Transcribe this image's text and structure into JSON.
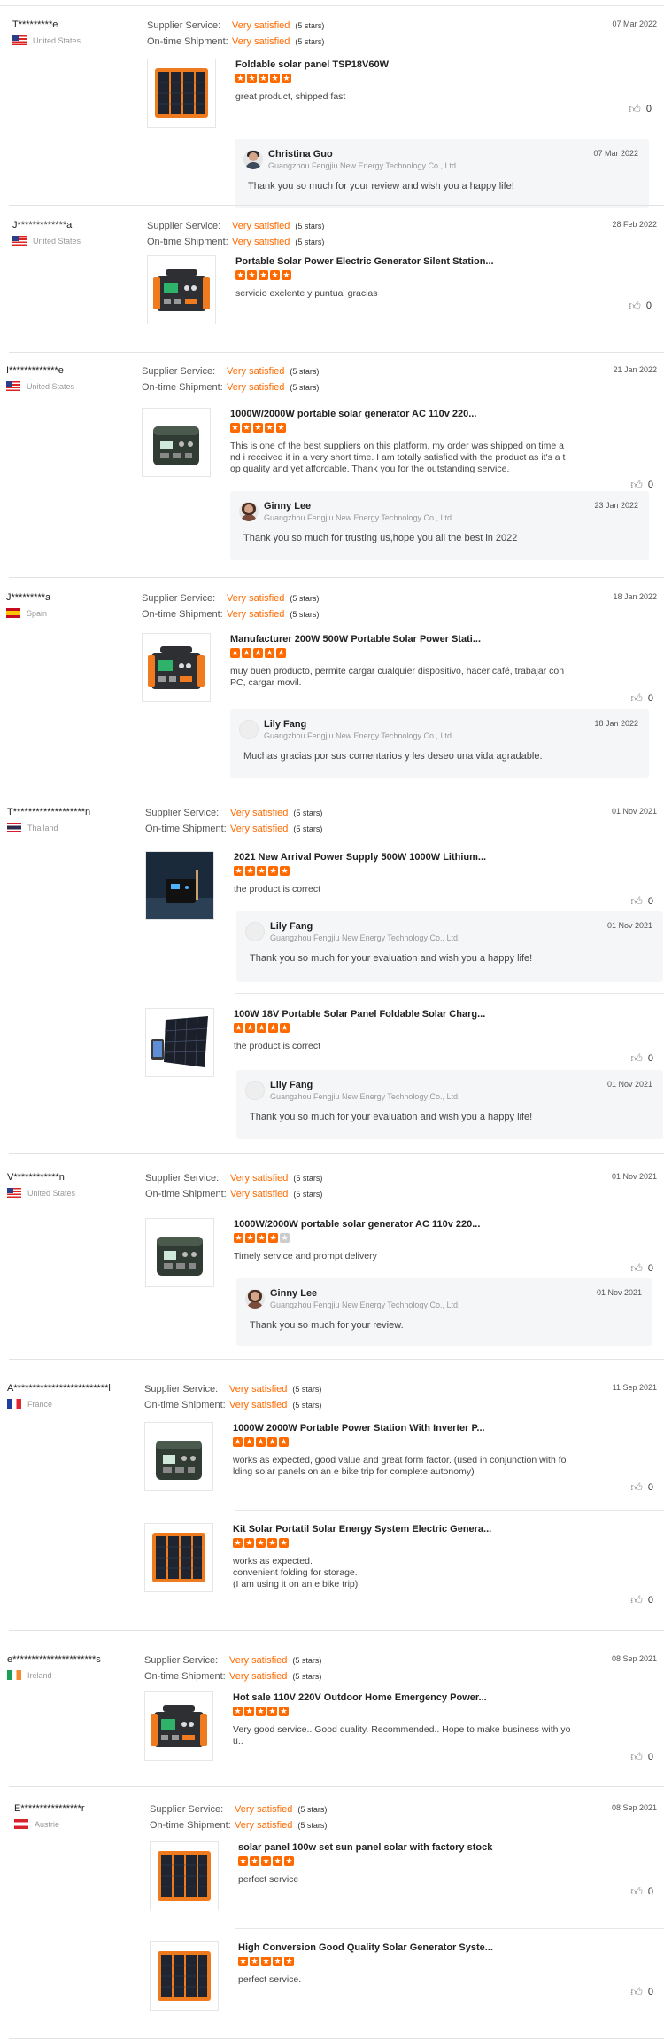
{
  "labels": {
    "supplier_service": "Supplier Service:",
    "ontime_shipment": "On-time Shipment:",
    "satisfied": "Very satisfied",
    "stars5": "(5 stars)"
  },
  "reviews": [
    {
      "buyer": "T*********e",
      "country": "United States",
      "flag": "us",
      "date": "07 Mar 2022",
      "product": {
        "title": "Foldable solar panel TSP18V60W",
        "stars": 5,
        "comment": "great product, shipped fast",
        "helpful": "0",
        "image": "solar-panel-icon"
      },
      "reply": {
        "name": "Christina Guo",
        "company": "Guangzhou Fengjiu New Energy Technology Co., Ltd.",
        "date": "07 Mar 2022",
        "text": "Thank you so much for your review and wish you a happy life!"
      }
    },
    {
      "buyer": "J*************a",
      "country": "United States",
      "flag": "us",
      "date": "28 Feb 2022",
      "product": {
        "title": "Portable Solar Power Electric Generator Silent Station...",
        "stars": 5,
        "comment": "servicio exelente y puntual gracias",
        "helpful": "0",
        "image": "orange-power-station-icon"
      }
    },
    {
      "buyer": "I*************e",
      "country": "United States",
      "flag": "us",
      "date": "21 Jan 2022",
      "product": {
        "title": "1000W/2000W portable solar generator AC 110v 220...",
        "stars": 5,
        "comment": "This is one of the best suppliers on this platform. my order was shipped on time a\nnd i received it in a very short time. I am totally satisfied with the product as it's a t\nop quality and yet affordable. Thank you for the outstanding service.",
        "helpful": "0",
        "image": "green-power-station-icon"
      },
      "reply": {
        "name": "Ginny Lee",
        "company": "Guangzhou Fengjiu New Energy Technology Co., Ltd.",
        "date": "23 Jan 2022",
        "text": "Thank you so much for trusting us,hope you all the best in 2022"
      }
    },
    {
      "buyer": "J*********a",
      "country": "Spain",
      "flag": "es",
      "date": "18 Jan 2022",
      "product": {
        "title": "Manufacturer 200W 500W Portable Solar Power Stati...",
        "stars": 5,
        "comment": "muy buen producto, permite cargar cualquier dispositivo, hacer café, trabajar con\nPC, cargar movil.",
        "helpful": "0",
        "image": "orange-power-station-icon"
      },
      "reply": {
        "name": "Lily Fang",
        "company": "Guangzhou Fengjiu New Energy Technology Co., Ltd.",
        "date": "18 Jan 2022",
        "text": "Muchas gracias por sus comentarios y les deseo una vida agradable."
      }
    },
    {
      "buyer": "T*******************n",
      "country": "Thailand",
      "flag": "th",
      "date": "01 Nov 2021",
      "products": [
        {
          "title": "2021 New Arrival Power Supply 500W 1000W Lithium...",
          "stars": 5,
          "comment": "the product is correct",
          "helpful": "0",
          "image": "dark-power-station-photo",
          "reply": {
            "name": "Lily Fang",
            "company": "Guangzhou Fengjiu New Energy Technology Co., Ltd.",
            "date": "01 Nov 2021",
            "text": "Thank you so much for your evaluation and wish you a happy life!"
          }
        },
        {
          "title": "100W 18V Portable Solar Panel Foldable Solar Charg...",
          "stars": 5,
          "comment": "the product is correct",
          "helpful": "0",
          "image": "solar-panel-black-icon",
          "reply": {
            "name": "Lily Fang",
            "company": "Guangzhou Fengjiu New Energy Technology Co., Ltd.",
            "date": "01 Nov 2021",
            "text": "Thank you so much for your evaluation and wish you a happy life!"
          }
        }
      ]
    },
    {
      "buyer": "V************n",
      "country": "United States",
      "flag": "us",
      "date": "01 Nov 2021",
      "product": {
        "title": "1000W/2000W portable solar generator AC 110v 220...",
        "stars": 4,
        "comment": "Timely service and prompt delivery",
        "helpful": "0",
        "image": "green-power-station-icon"
      },
      "reply": {
        "name": "Ginny Lee",
        "company": "Guangzhou Fengjiu New Energy Technology Co., Ltd.",
        "date": "01 Nov 2021",
        "text": "Thank you so much for your review."
      }
    },
    {
      "buyer": "A*************************l",
      "country": "France",
      "flag": "fr",
      "date": "11 Sep 2021",
      "products": [
        {
          "title": "1000W 2000W Portable Power Station With Inverter P...",
          "stars": 5,
          "comment": "works as expected, good value and great form factor. (used in conjunction with fo\nlding solar panels on an e bike trip  for complete autonomy)",
          "helpful": "0",
          "image": "green-power-station-icon"
        },
        {
          "title": "Kit Solar Portatil Solar Energy System Electric Genera...",
          "stars": 5,
          "comment": "works as expected.\nconvenient folding for storage.\n(I am using it on an e bike trip)",
          "helpful": "0",
          "image": "solar-panel-icon"
        }
      ]
    },
    {
      "buyer": "e**********************s",
      "country": "Ireland",
      "flag": "ie",
      "date": "08 Sep 2021",
      "product": {
        "title": "Hot sale 110V 220V Outdoor Home Emergency Power...",
        "stars": 5,
        "comment": "Very good service.. Good quality. Recommended.. Hope to make business with yo\nu..",
        "helpful": "0",
        "image": "orange-power-station-icon"
      }
    },
    {
      "buyer": "E****************r",
      "country": "Austrie",
      "flag": "at",
      "date": "08 Sep 2021",
      "products": [
        {
          "title": "solar panel 100w set sun panel solar with factory stock",
          "stars": 5,
          "comment": "perfect service",
          "helpful": "0",
          "image": "solar-panel-icon"
        },
        {
          "title": "High Conversion Good Quality Solar Generator Syste...",
          "stars": 5,
          "comment": "perfect service.",
          "helpful": "0",
          "image": "solar-panel-icon"
        }
      ]
    }
  ]
}
